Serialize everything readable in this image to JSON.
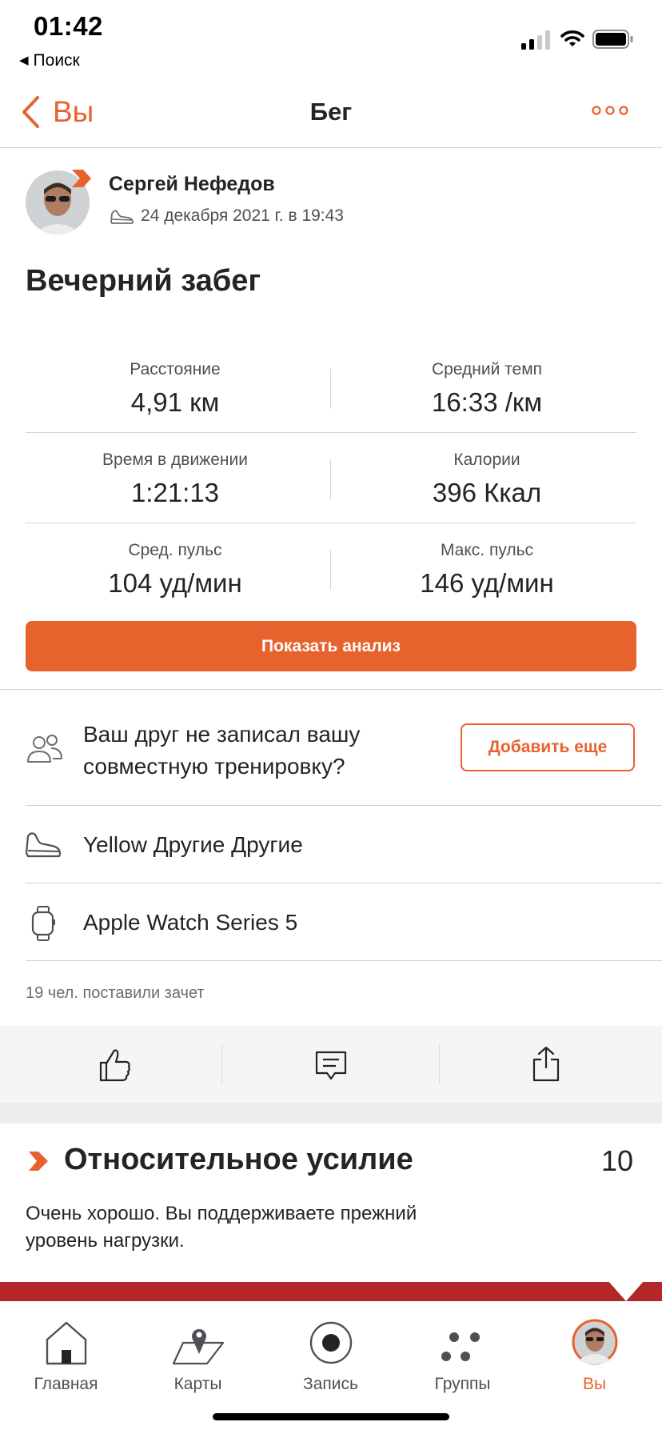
{
  "status_bar": {
    "time": "01:42",
    "back_app": "Поиск"
  },
  "nav": {
    "back_label": "Вы",
    "title": "Бег"
  },
  "activity": {
    "athlete": "Сергей Нефедов",
    "datetime": "24 декабря 2021 г. в 19:43",
    "title": "Вечерний забег"
  },
  "stats": [
    {
      "label": "Расстояние",
      "value": "4,91 км"
    },
    {
      "label": "Средний темп",
      "value": "16:33 /км"
    },
    {
      "label": "Время в движении",
      "value": "1:21:13"
    },
    {
      "label": "Калории",
      "value": "396 Ккал"
    },
    {
      "label": "Сред. пульс",
      "value": "104 уд/мин"
    },
    {
      "label": "Макс. пульс",
      "value": "146 уд/мин"
    }
  ],
  "analysis_button": "Показать анализ",
  "friend_prompt": {
    "text": "Ваш друг не записал вашу совместную тренировку?",
    "button": "Добавить еще"
  },
  "gear": "Yellow Другие Другие",
  "device": "Apple Watch Series 5",
  "kudos": "19 чел. поставили зачет",
  "relative_effort": {
    "title": "Относительное усилие",
    "value": "10",
    "description": "Очень хорошо. Вы поддерживаете прежний уровень нагрузки."
  },
  "tabs": [
    {
      "label": "Главная",
      "icon": "home-icon"
    },
    {
      "label": "Карты",
      "icon": "map-icon"
    },
    {
      "label": "Запись",
      "icon": "record-icon"
    },
    {
      "label": "Группы",
      "icon": "groups-icon"
    },
    {
      "label": "Вы",
      "icon": "avatar",
      "active": true
    }
  ],
  "colors": {
    "accent": "#e8622d",
    "effort_bar": "#b32729",
    "text": "#242428",
    "muted": "#4f4f55"
  }
}
